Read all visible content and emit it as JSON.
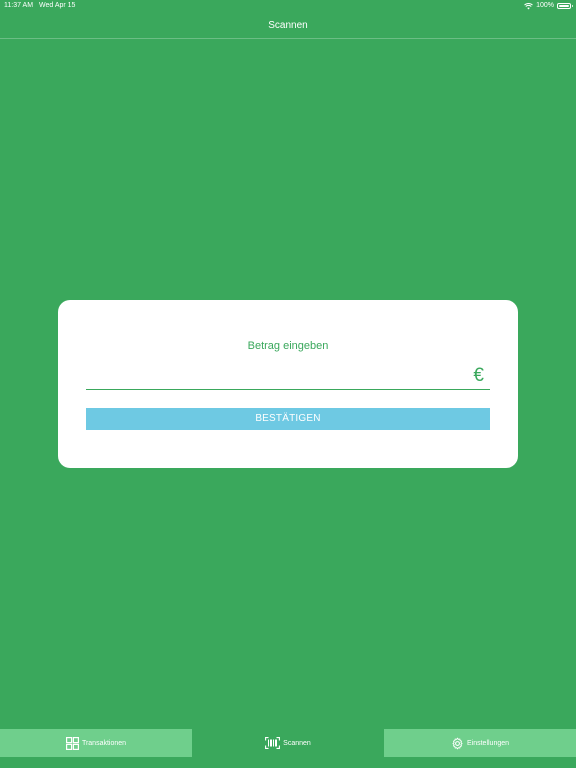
{
  "status_bar": {
    "time": "11:37 AM",
    "date": "Wed Apr 15",
    "battery": "100%"
  },
  "nav": {
    "title": "Scannen"
  },
  "amount_dialog": {
    "prompt": "Betrag eingeben",
    "input_value": "",
    "currency_symbol": "€",
    "confirm_label": "BESTÄTIGEN"
  },
  "tab_bar": {
    "tabs": [
      {
        "label": "Transaktionen",
        "icon": "grid-icon",
        "selected": false
      },
      {
        "label": "Scannen",
        "icon": "barcode-icon",
        "selected": true
      },
      {
        "label": "Einstellungen",
        "icon": "gear-icon",
        "selected": false
      }
    ]
  },
  "colors": {
    "background": "#3aa85c",
    "tab_inactive": "#6fcf8c",
    "button": "#6ec9e3",
    "accent": "#3aa85c"
  }
}
